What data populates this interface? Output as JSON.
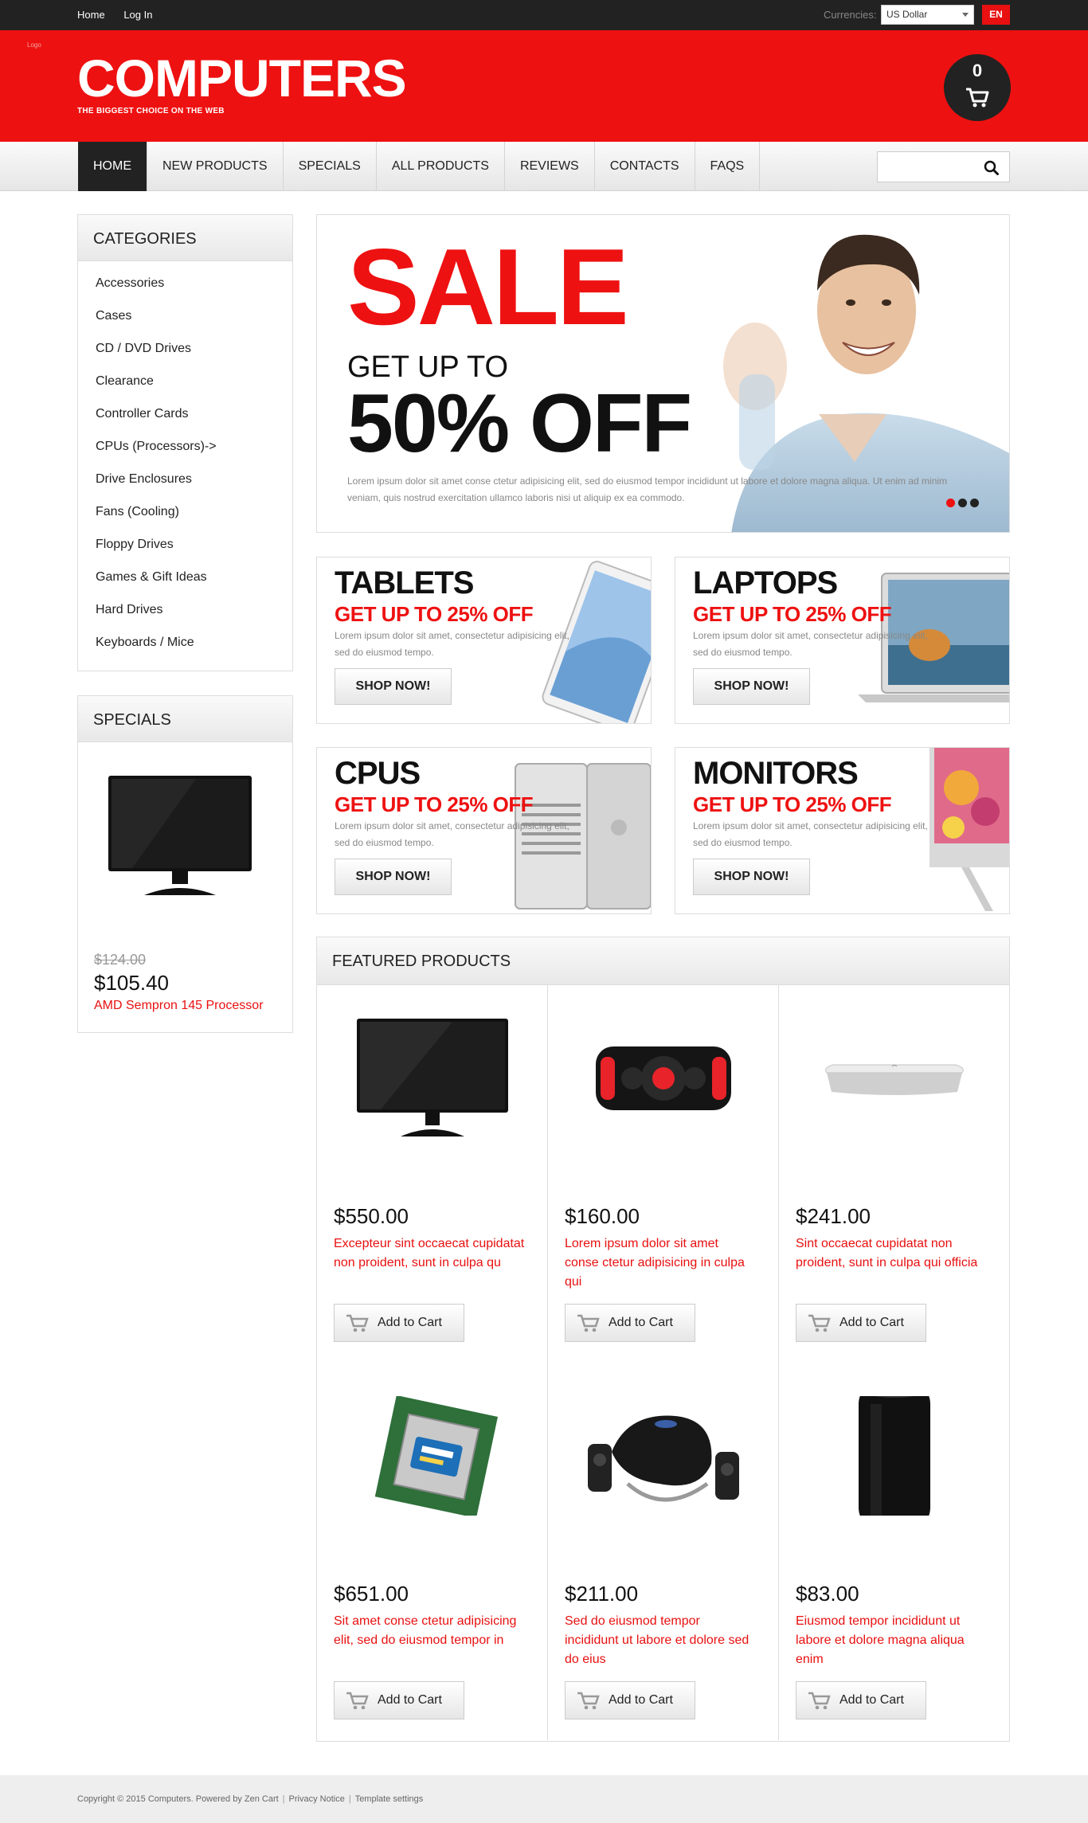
{
  "topbar": {
    "links": [
      "Home",
      "Log In"
    ],
    "currency_label": "Currencies:",
    "currency_value": "US Dollar",
    "language": "EN"
  },
  "header": {
    "tiny_text": "Logo",
    "title": "COMPUTERS",
    "subtitle": "THE BIGGEST CHOICE ON THE WEB",
    "cart_count": "0"
  },
  "nav": {
    "items": [
      "HOME",
      "NEW PRODUCTS",
      "SPECIALS",
      "ALL PRODUCTS",
      "REVIEWS",
      "CONTACTS",
      "FAQS"
    ],
    "active": "HOME"
  },
  "categories": {
    "title": "CATEGORIES",
    "items": [
      "Accessories",
      "Cases",
      "CD / DVD Drives",
      "Clearance",
      "Controller Cards",
      "CPUs (Processors)->",
      "Drive Enclosures",
      "Fans (Cooling)",
      "Floppy Drives",
      "Games & Gift Ideas",
      "Hard Drives",
      "Keyboards / Mice"
    ]
  },
  "specials": {
    "title": "SPECIALS",
    "old_price": "$124.00",
    "price": "$105.40",
    "name": "AMD Sempron 145 Processor"
  },
  "banner": {
    "sale": "SALE",
    "getup": "GET UP TO",
    "off": "50% OFF",
    "lorem": "Lorem ipsum dolor sit amet conse ctetur adipisicing elit, sed do eiusmod tempor incididunt ut labore et dolore magna aliqua. Ut enim ad minim veniam, quis nostrud exercitation ullamco laboris nisi ut aliquip ex ea commodo."
  },
  "promos": [
    {
      "title": "TABLETS",
      "sub": "GET UP TO 25% OFF",
      "lorem": "Lorem ipsum dolor sit amet, consectetur adipisicing elit, sed do eiusmod tempo.",
      "button": "SHOP NOW!"
    },
    {
      "title": "LAPTOPS",
      "sub": "GET UP TO 25% OFF",
      "lorem": "Lorem ipsum dolor sit amet, consectetur adipisicing elit, sed do eiusmod tempo.",
      "button": "SHOP NOW!"
    },
    {
      "title": "CPUS",
      "sub": "GET UP TO 25% OFF",
      "lorem": "Lorem ipsum dolor sit amet, consectetur adipisicing elit, sed do eiusmod tempo.",
      "button": "SHOP NOW!"
    },
    {
      "title": "MONITORS",
      "sub": "GET UP TO 25% OFF",
      "lorem": "Lorem ipsum dolor sit amet, consectetur adipisicing elit, sed do eiusmod tempo.",
      "button": "SHOP NOW!"
    }
  ],
  "featured": {
    "title": "FEATURED PRODUCTS",
    "add_label": "Add to Cart",
    "products": [
      {
        "price": "$550.00",
        "name": "Excepteur sint occaecat cupidatat non proident, sunt in culpa qu",
        "icon": "monitor"
      },
      {
        "price": "$160.00",
        "name": "Lorem ipsum dolor sit amet conse ctetur adipisicing in culpa qui",
        "icon": "speaker"
      },
      {
        "price": "$241.00",
        "name": "Sint occaecat cupidatat non proident, sunt in culpa qui officia",
        "icon": "mini-pc"
      },
      {
        "price": "$651.00",
        "name": "Sit amet conse ctetur adipisicing elit, sed do eiusmod tempor in",
        "icon": "cpu-chip"
      },
      {
        "price": "$211.00",
        "name": "Sed do eiusmod tempor incididunt ut labore et dolore sed do eius",
        "icon": "speaker-set"
      },
      {
        "price": "$83.00",
        "name": "Eiusmod tempor incididunt ut labore et dolore magna aliqua enim",
        "icon": "cylinder-pc"
      }
    ]
  },
  "footer": {
    "copyright": "Copyright © 2015 Computers. Powered by Zen Cart",
    "privacy": "Privacy Notice",
    "template": "Template settings"
  },
  "colors": {
    "brand_red": "#ee1111",
    "dark": "#222222"
  }
}
